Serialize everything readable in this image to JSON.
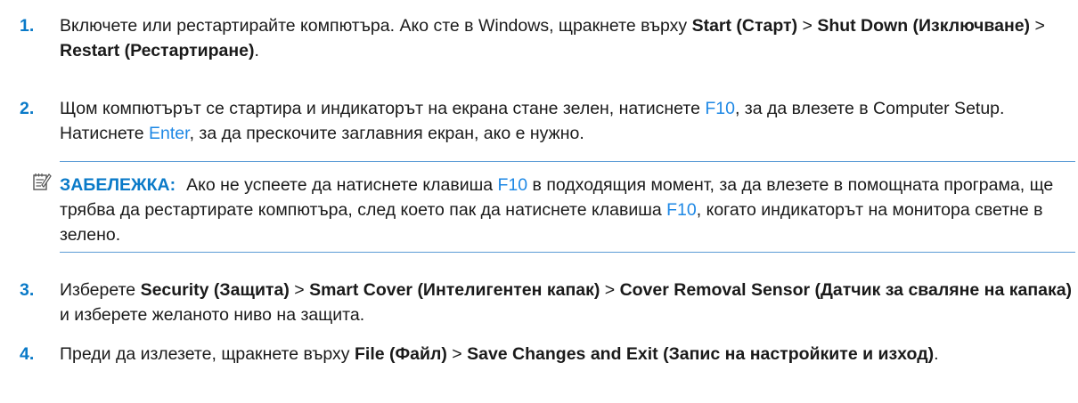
{
  "steps": [
    {
      "num": "1.",
      "parts": [
        {
          "t": "Включете или рестартирайте компютъра. Ако сте в Windows, щракнете върху "
        },
        {
          "t": "Start (Старт)",
          "b": true
        },
        {
          "t": " > "
        },
        {
          "t": "Shut Down (Изключване)",
          "b": true
        },
        {
          "t": " > "
        },
        {
          "t": "Restart (Рестартиране)",
          "b": true
        },
        {
          "t": "."
        }
      ]
    },
    {
      "num": "2.",
      "parts": [
        {
          "t": "Щом компютърът се стартира и индикаторът на екрана стане зелен, натиснете "
        },
        {
          "t": "F10",
          "k": true
        },
        {
          "t": ", за да влезете в Computer Setup. Натиснете "
        },
        {
          "t": "Enter",
          "k": true
        },
        {
          "t": ", за да прескочите заглавния екран, ако е нужно."
        }
      ]
    },
    {
      "num": "3.",
      "parts": [
        {
          "t": "Изберете "
        },
        {
          "t": "Security (Защита)",
          "b": true
        },
        {
          "t": " > "
        },
        {
          "t": "Smart Cover (Интелигентен капак)",
          "b": true
        },
        {
          "t": " > "
        },
        {
          "t": "Cover Removal Sensor (Датчик за сваляне на капака)",
          "b": true
        },
        {
          "t": " и изберете желаното ниво на защита."
        }
      ]
    },
    {
      "num": "4.",
      "parts": [
        {
          "t": "Преди да излезете, щракнете върху "
        },
        {
          "t": "File (Файл)",
          "b": true
        },
        {
          "t": " > "
        },
        {
          "t": "Save Changes and Exit (Запис на настройките и изход)",
          "b": true
        },
        {
          "t": "."
        }
      ]
    }
  ],
  "note": {
    "label": "ЗАБЕЛЕЖКА:",
    "icon": "note-pad-icon",
    "parts": [
      {
        "t": "Ако не успеете да натиснете клавиша "
      },
      {
        "t": "F10",
        "k": true
      },
      {
        "t": " в подходящия момент, за да влезете в помощната програма, ще трябва да рестартирате компютъра, след което пак да натиснете клавиша "
      },
      {
        "t": "F10",
        "k": true
      },
      {
        "t": ", когато индикаторът на монитора светне в зелено."
      }
    ]
  },
  "colors": {
    "accent": "#0a7ac8",
    "key": "#1e88e5",
    "rule": "#5b9bd5",
    "text": "#1a1a1a"
  }
}
